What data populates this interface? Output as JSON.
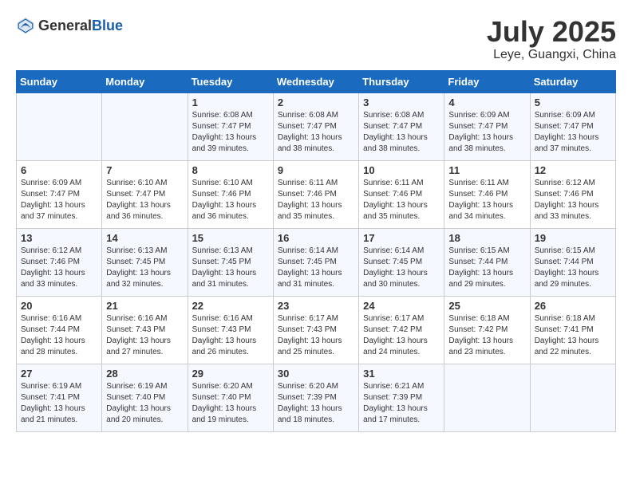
{
  "header": {
    "logo_general": "General",
    "logo_blue": "Blue",
    "month": "July 2025",
    "location": "Leye, Guangxi, China"
  },
  "weekdays": [
    "Sunday",
    "Monday",
    "Tuesday",
    "Wednesday",
    "Thursday",
    "Friday",
    "Saturday"
  ],
  "weeks": [
    [
      {
        "day": null,
        "info": null
      },
      {
        "day": null,
        "info": null
      },
      {
        "day": "1",
        "info": "Sunrise: 6:08 AM\nSunset: 7:47 PM\nDaylight: 13 hours and 39 minutes."
      },
      {
        "day": "2",
        "info": "Sunrise: 6:08 AM\nSunset: 7:47 PM\nDaylight: 13 hours and 38 minutes."
      },
      {
        "day": "3",
        "info": "Sunrise: 6:08 AM\nSunset: 7:47 PM\nDaylight: 13 hours and 38 minutes."
      },
      {
        "day": "4",
        "info": "Sunrise: 6:09 AM\nSunset: 7:47 PM\nDaylight: 13 hours and 38 minutes."
      },
      {
        "day": "5",
        "info": "Sunrise: 6:09 AM\nSunset: 7:47 PM\nDaylight: 13 hours and 37 minutes."
      }
    ],
    [
      {
        "day": "6",
        "info": "Sunrise: 6:09 AM\nSunset: 7:47 PM\nDaylight: 13 hours and 37 minutes."
      },
      {
        "day": "7",
        "info": "Sunrise: 6:10 AM\nSunset: 7:47 PM\nDaylight: 13 hours and 36 minutes."
      },
      {
        "day": "8",
        "info": "Sunrise: 6:10 AM\nSunset: 7:46 PM\nDaylight: 13 hours and 36 minutes."
      },
      {
        "day": "9",
        "info": "Sunrise: 6:11 AM\nSunset: 7:46 PM\nDaylight: 13 hours and 35 minutes."
      },
      {
        "day": "10",
        "info": "Sunrise: 6:11 AM\nSunset: 7:46 PM\nDaylight: 13 hours and 35 minutes."
      },
      {
        "day": "11",
        "info": "Sunrise: 6:11 AM\nSunset: 7:46 PM\nDaylight: 13 hours and 34 minutes."
      },
      {
        "day": "12",
        "info": "Sunrise: 6:12 AM\nSunset: 7:46 PM\nDaylight: 13 hours and 33 minutes."
      }
    ],
    [
      {
        "day": "13",
        "info": "Sunrise: 6:12 AM\nSunset: 7:46 PM\nDaylight: 13 hours and 33 minutes."
      },
      {
        "day": "14",
        "info": "Sunrise: 6:13 AM\nSunset: 7:45 PM\nDaylight: 13 hours and 32 minutes."
      },
      {
        "day": "15",
        "info": "Sunrise: 6:13 AM\nSunset: 7:45 PM\nDaylight: 13 hours and 31 minutes."
      },
      {
        "day": "16",
        "info": "Sunrise: 6:14 AM\nSunset: 7:45 PM\nDaylight: 13 hours and 31 minutes."
      },
      {
        "day": "17",
        "info": "Sunrise: 6:14 AM\nSunset: 7:45 PM\nDaylight: 13 hours and 30 minutes."
      },
      {
        "day": "18",
        "info": "Sunrise: 6:15 AM\nSunset: 7:44 PM\nDaylight: 13 hours and 29 minutes."
      },
      {
        "day": "19",
        "info": "Sunrise: 6:15 AM\nSunset: 7:44 PM\nDaylight: 13 hours and 29 minutes."
      }
    ],
    [
      {
        "day": "20",
        "info": "Sunrise: 6:16 AM\nSunset: 7:44 PM\nDaylight: 13 hours and 28 minutes."
      },
      {
        "day": "21",
        "info": "Sunrise: 6:16 AM\nSunset: 7:43 PM\nDaylight: 13 hours and 27 minutes."
      },
      {
        "day": "22",
        "info": "Sunrise: 6:16 AM\nSunset: 7:43 PM\nDaylight: 13 hours and 26 minutes."
      },
      {
        "day": "23",
        "info": "Sunrise: 6:17 AM\nSunset: 7:43 PM\nDaylight: 13 hours and 25 minutes."
      },
      {
        "day": "24",
        "info": "Sunrise: 6:17 AM\nSunset: 7:42 PM\nDaylight: 13 hours and 24 minutes."
      },
      {
        "day": "25",
        "info": "Sunrise: 6:18 AM\nSunset: 7:42 PM\nDaylight: 13 hours and 23 minutes."
      },
      {
        "day": "26",
        "info": "Sunrise: 6:18 AM\nSunset: 7:41 PM\nDaylight: 13 hours and 22 minutes."
      }
    ],
    [
      {
        "day": "27",
        "info": "Sunrise: 6:19 AM\nSunset: 7:41 PM\nDaylight: 13 hours and 21 minutes."
      },
      {
        "day": "28",
        "info": "Sunrise: 6:19 AM\nSunset: 7:40 PM\nDaylight: 13 hours and 20 minutes."
      },
      {
        "day": "29",
        "info": "Sunrise: 6:20 AM\nSunset: 7:40 PM\nDaylight: 13 hours and 19 minutes."
      },
      {
        "day": "30",
        "info": "Sunrise: 6:20 AM\nSunset: 7:39 PM\nDaylight: 13 hours and 18 minutes."
      },
      {
        "day": "31",
        "info": "Sunrise: 6:21 AM\nSunset: 7:39 PM\nDaylight: 13 hours and 17 minutes."
      },
      {
        "day": null,
        "info": null
      },
      {
        "day": null,
        "info": null
      }
    ]
  ]
}
